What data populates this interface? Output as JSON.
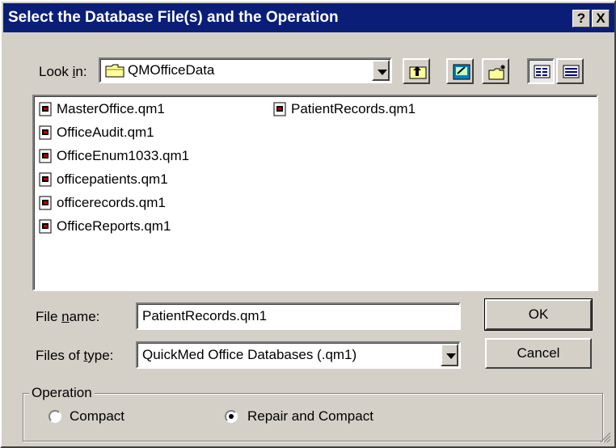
{
  "window": {
    "title": "Select the Database File(s) and the Operation",
    "help_button": "?",
    "close_button": "X"
  },
  "look_in": {
    "label_prefix": "Look ",
    "label_accel": "i",
    "label_suffix": "n:",
    "value": "QMOfficeData"
  },
  "toolbar": {
    "icons": [
      "up-one-level-icon",
      "desktop-icon",
      "new-folder-icon",
      "list-view-icon",
      "details-view-icon"
    ]
  },
  "files": {
    "column1": [
      "MasterOffice.qm1",
      "OfficeAudit.qm1",
      "OfficeEnum1033.qm1",
      "officepatients.qm1",
      "officerecords.qm1",
      "OfficeReports.qm1"
    ],
    "column2": [
      "PatientRecords.qm1"
    ]
  },
  "file_name": {
    "label_prefix": "File ",
    "label_accel": "n",
    "label_suffix": "ame:",
    "value": "PatientRecords.qm1"
  },
  "file_type": {
    "label_prefix": "Files of ",
    "label_accel": "t",
    "label_suffix": "ype:",
    "value": "QuickMed Office Databases (.qm1)"
  },
  "buttons": {
    "ok": "OK",
    "cancel": "Cancel"
  },
  "operation": {
    "title": "Operation",
    "options": [
      "Compact",
      "Repair and Compact"
    ],
    "selected": "Repair and Compact"
  },
  "colors": {
    "titlebar": "#0a1e78",
    "face": "#d4d0c8"
  }
}
